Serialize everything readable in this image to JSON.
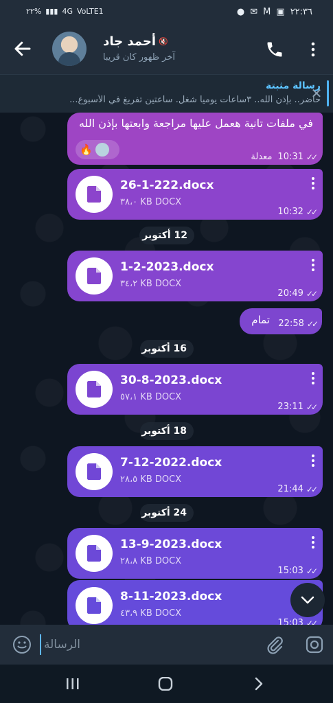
{
  "status_bar": {
    "time": "٢٢:٣٦",
    "battery": "٢٢%",
    "network": "4G",
    "lte": "VoLTE1"
  },
  "header": {
    "contact_name": "أحمد جاد",
    "last_seen": "آخر ظهور كان قريبا"
  },
  "pinned": {
    "title": "رسالة مثبتة",
    "text": "حاضر.. بإذن الله.. ٣ساعات يوميا شغل.  ساعتين تفريغ في الأسبوع..."
  },
  "messages": [
    {
      "type": "text",
      "text": "في ملفات تانية هعمل عليها مراجعة وابعتها بإذن الله",
      "edited": "معدلة",
      "time": "10:31",
      "reaction": "🔥"
    },
    {
      "type": "file",
      "name": "26-1-222.docx",
      "size": "٣٨،٠ KB DOCX",
      "time": "10:32"
    },
    {
      "type": "date",
      "label": "12 أكتوبر"
    },
    {
      "type": "file",
      "name": "1-2-2023.docx",
      "size": "٣٤،٢ KB DOCX",
      "time": "20:49"
    },
    {
      "type": "text",
      "text": "تمام",
      "time": "22:58"
    },
    {
      "type": "date",
      "label": "16 أكتوبر"
    },
    {
      "type": "file",
      "name": "30-8-2023.docx",
      "size": "٥٧،١ KB DOCX",
      "time": "23:11"
    },
    {
      "type": "date",
      "label": "18 أكتوبر"
    },
    {
      "type": "file",
      "name": "7-12-2022.docx",
      "size": "٢٨،٥ KB DOCX",
      "time": "21:44"
    },
    {
      "type": "date",
      "label": "24 أكتوبر"
    },
    {
      "type": "file",
      "name": "13-9-2023.docx",
      "size": "٢٨،٨ KB DOCX",
      "time": "15:03"
    },
    {
      "type": "file",
      "name": "8-11-2023.docx",
      "size": "٤٣،٩ KB DOCX",
      "time": "15:03"
    }
  ],
  "input": {
    "placeholder": "الرسالة"
  },
  "icons": {
    "back": "arrow-left-icon",
    "call": "phone-icon",
    "menu": "more-vertical-icon",
    "emoji": "smile-icon",
    "attach": "paperclip-icon",
    "camera": "camera-icon",
    "file": "document-icon"
  },
  "colors": {
    "accent": "#5cc2ff",
    "bubble_top": "#9e45c4",
    "bubble_bottom": "#654bdb"
  }
}
